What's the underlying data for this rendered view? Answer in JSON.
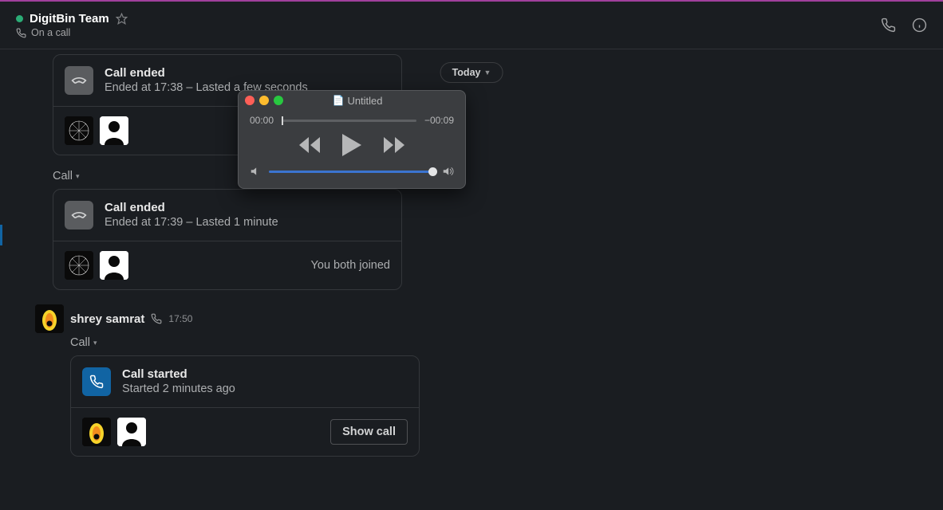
{
  "header": {
    "title": "DigitBin Team",
    "subtitle": "On a call"
  },
  "date_divider": "Today",
  "call_cards": [
    {
      "title": "Call ended",
      "subtitle": "Ended at 17:38 – Lasted a few seconds",
      "footer_text": ""
    },
    {
      "title": "Call ended",
      "subtitle": "Ended at 17:39 – Lasted 1 minute",
      "footer_text": "You both joined"
    },
    {
      "title": "Call started",
      "subtitle": "Started 2 minutes ago",
      "footer_button": "Show call"
    }
  ],
  "call_label": "Call",
  "message": {
    "author": "shrey samrat",
    "time": "17:50"
  },
  "media_player": {
    "title": "Untitled",
    "time_elapsed": "00:00",
    "time_remaining": "−00:09"
  }
}
